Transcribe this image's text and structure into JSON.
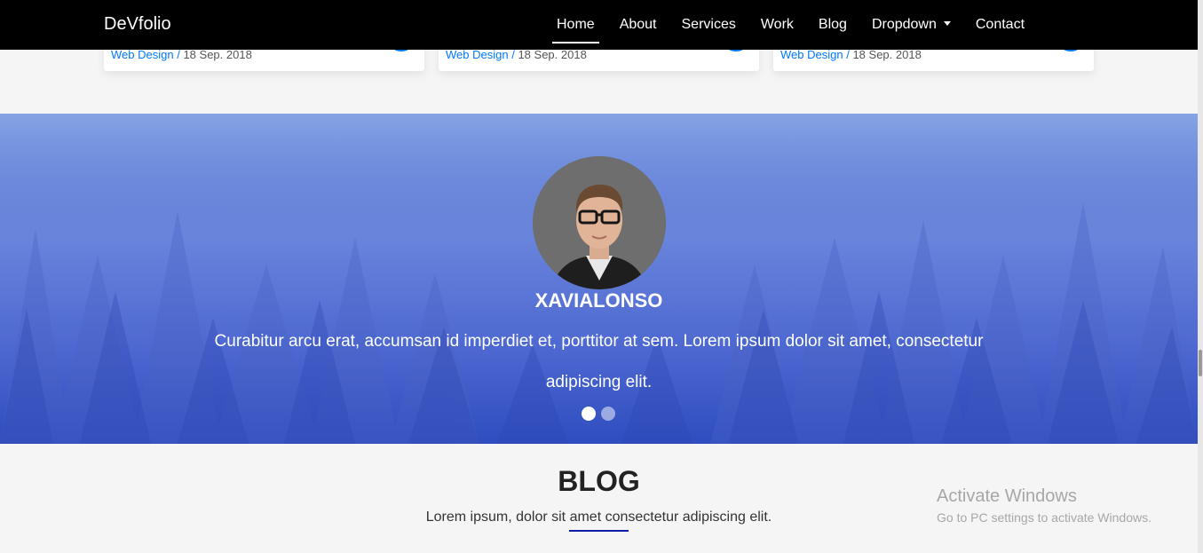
{
  "navbar": {
    "brand": "DeVfolio",
    "items": [
      {
        "label": "Home"
      },
      {
        "label": "About"
      },
      {
        "label": "Services"
      },
      {
        "label": "Work"
      },
      {
        "label": "Blog"
      },
      {
        "label": "Dropdown"
      },
      {
        "label": "Contact"
      }
    ]
  },
  "blog_cards": [
    {
      "category": "Web Design",
      "separator": "/",
      "date": "18 Sep. 2018"
    },
    {
      "category": "Web Design",
      "separator": "/",
      "date": "18 Sep. 2018"
    },
    {
      "category": "Web Design",
      "separator": "/",
      "date": "18 Sep. 2018"
    }
  ],
  "testimonial": {
    "name": "XAVIALONSO",
    "text_line1": "Curabitur arcu erat, accumsan id imperdiet et, porttitor at sem. Lorem ipsum dolor sit amet, consectetur",
    "text_line2": "adipiscing elit."
  },
  "blog": {
    "title": "BLOG",
    "subtitle": "Lorem ipsum, dolor sit amet consectetur adipiscing elit."
  },
  "watermark": {
    "line1": "Activate Windows",
    "line2": "Go to PC settings to activate Windows."
  },
  "colors": {
    "accent": "#0078ff",
    "navbar_bg": "#000000",
    "blog_underline": "#0d1ea6"
  }
}
